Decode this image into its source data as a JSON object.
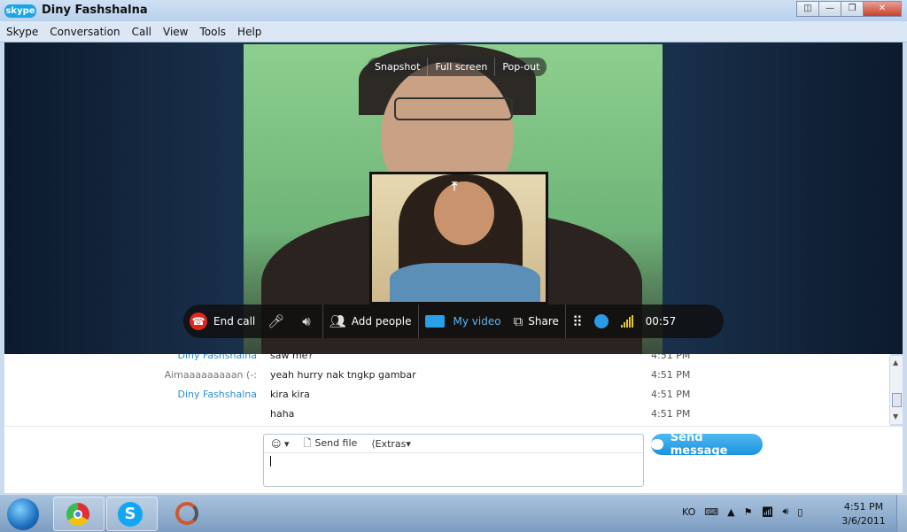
{
  "window": {
    "logo": "skype",
    "title": "Diny Fashshalna",
    "buttons": [
      "◫",
      "—",
      "❐",
      "✕"
    ]
  },
  "menu": [
    "Skype",
    "Conversation",
    "Call",
    "View",
    "Tools",
    "Help"
  ],
  "video_controls": {
    "snapshot": "Snapshot",
    "fullscreen": "Full screen",
    "popout": "Pop-out"
  },
  "call_bar": {
    "end_call": "End call",
    "add_people": "Add people",
    "my_video": "My video",
    "share": "Share",
    "timer": "00:57"
  },
  "chat": {
    "messages": [
      {
        "name": "Diny Fashshalna",
        "text": "saw me?",
        "time": "4:51 PM"
      },
      {
        "name": "Aimaaaaaaaaan (-:",
        "text": "yeah hurry nak tngkp gambar",
        "time": "4:51 PM"
      },
      {
        "name": "Diny Fashshalna",
        "text": "kira kira",
        "time": "4:51 PM"
      },
      {
        "name": "",
        "text": "haha",
        "time": "4:51 PM"
      }
    ]
  },
  "composer": {
    "emoticon": "☺ ▾",
    "send_file": "Send file",
    "extras": "Extras▾",
    "send_button": "Send message"
  },
  "taskbar": {
    "lang": "KO",
    "time": "4:51 PM",
    "date": "3/6/2011"
  }
}
